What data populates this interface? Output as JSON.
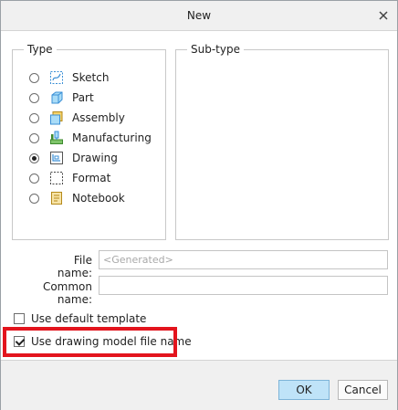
{
  "window": {
    "title": "New"
  },
  "type_group": {
    "legend": "Type",
    "selected": "Drawing",
    "options": [
      {
        "label": "Sketch",
        "icon": "sketch-icon",
        "checked": false
      },
      {
        "label": "Part",
        "icon": "part-icon",
        "checked": false
      },
      {
        "label": "Assembly",
        "icon": "assembly-icon",
        "checked": false
      },
      {
        "label": "Manufacturing",
        "icon": "manufacturing-icon",
        "checked": false
      },
      {
        "label": "Drawing",
        "icon": "drawing-icon",
        "checked": true
      },
      {
        "label": "Format",
        "icon": "format-icon",
        "checked": false
      },
      {
        "label": "Notebook",
        "icon": "notebook-icon",
        "checked": false
      }
    ]
  },
  "subtype_group": {
    "legend": "Sub-type"
  },
  "file_name": {
    "label": "File name:",
    "value": "",
    "placeholder": "<Generated>"
  },
  "common_name": {
    "label": "Common name:",
    "value": ""
  },
  "options": {
    "use_default_template": {
      "label": "Use default template",
      "checked": false
    },
    "use_drawing_model_file_name": {
      "label": "Use drawing model file name",
      "checked": true
    }
  },
  "buttons": {
    "ok": "OK",
    "cancel": "Cancel"
  },
  "colors": {
    "highlight": "#e3141d",
    "ok_button": "#bfe3f8",
    "accent_blue": "#3a8fd6"
  }
}
